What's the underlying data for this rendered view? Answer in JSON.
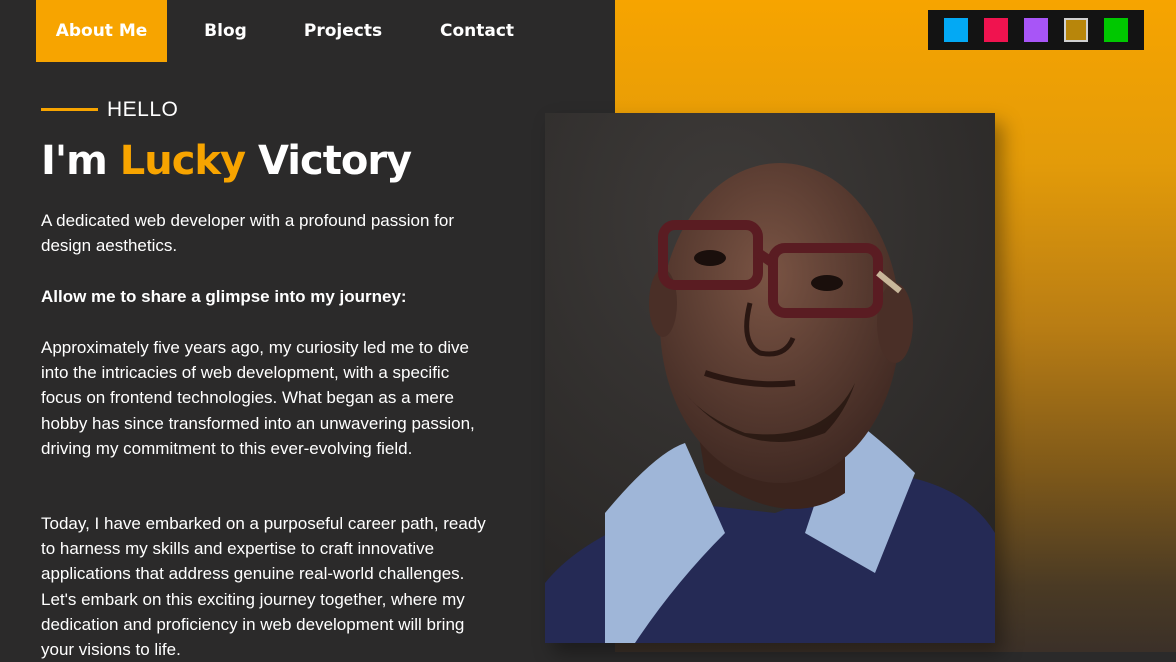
{
  "nav": {
    "items": [
      {
        "label": "About Me"
      },
      {
        "label": "Blog"
      },
      {
        "label": "Projects"
      },
      {
        "label": "Contact"
      }
    ]
  },
  "theme_swatches": [
    {
      "color": "#03a9f4"
    },
    {
      "color": "#f0134f"
    },
    {
      "color": "#a855f7"
    },
    {
      "color": "#b8860b"
    },
    {
      "color": "#00c800"
    }
  ],
  "hero": {
    "greeting": "HELLO",
    "title_prefix": "I'm",
    "title_first": "Lucky",
    "title_last": "Victory",
    "intro": "A dedicated web developer with a profound passion for design aesthetics.",
    "subheading": "Allow me to share a glimpse into my journey:",
    "para1": "Approximately five years ago, my curiosity led me to dive into the intricacies of web development, with a specific focus on frontend technologies. What began as a mere hobby has since transformed into an unwavering passion, driving my commitment to this ever-evolving field.",
    "para2": "Today, I have embarked on a purposeful career path, ready to harness my skills and expertise to craft innovative applications that address genuine real-world challenges. Let's embark on this exciting journey together, where my dedication and proficiency in web development will bring your visions to life."
  },
  "colors": {
    "accent": "#f7a400",
    "background": "#2b2a2a"
  }
}
